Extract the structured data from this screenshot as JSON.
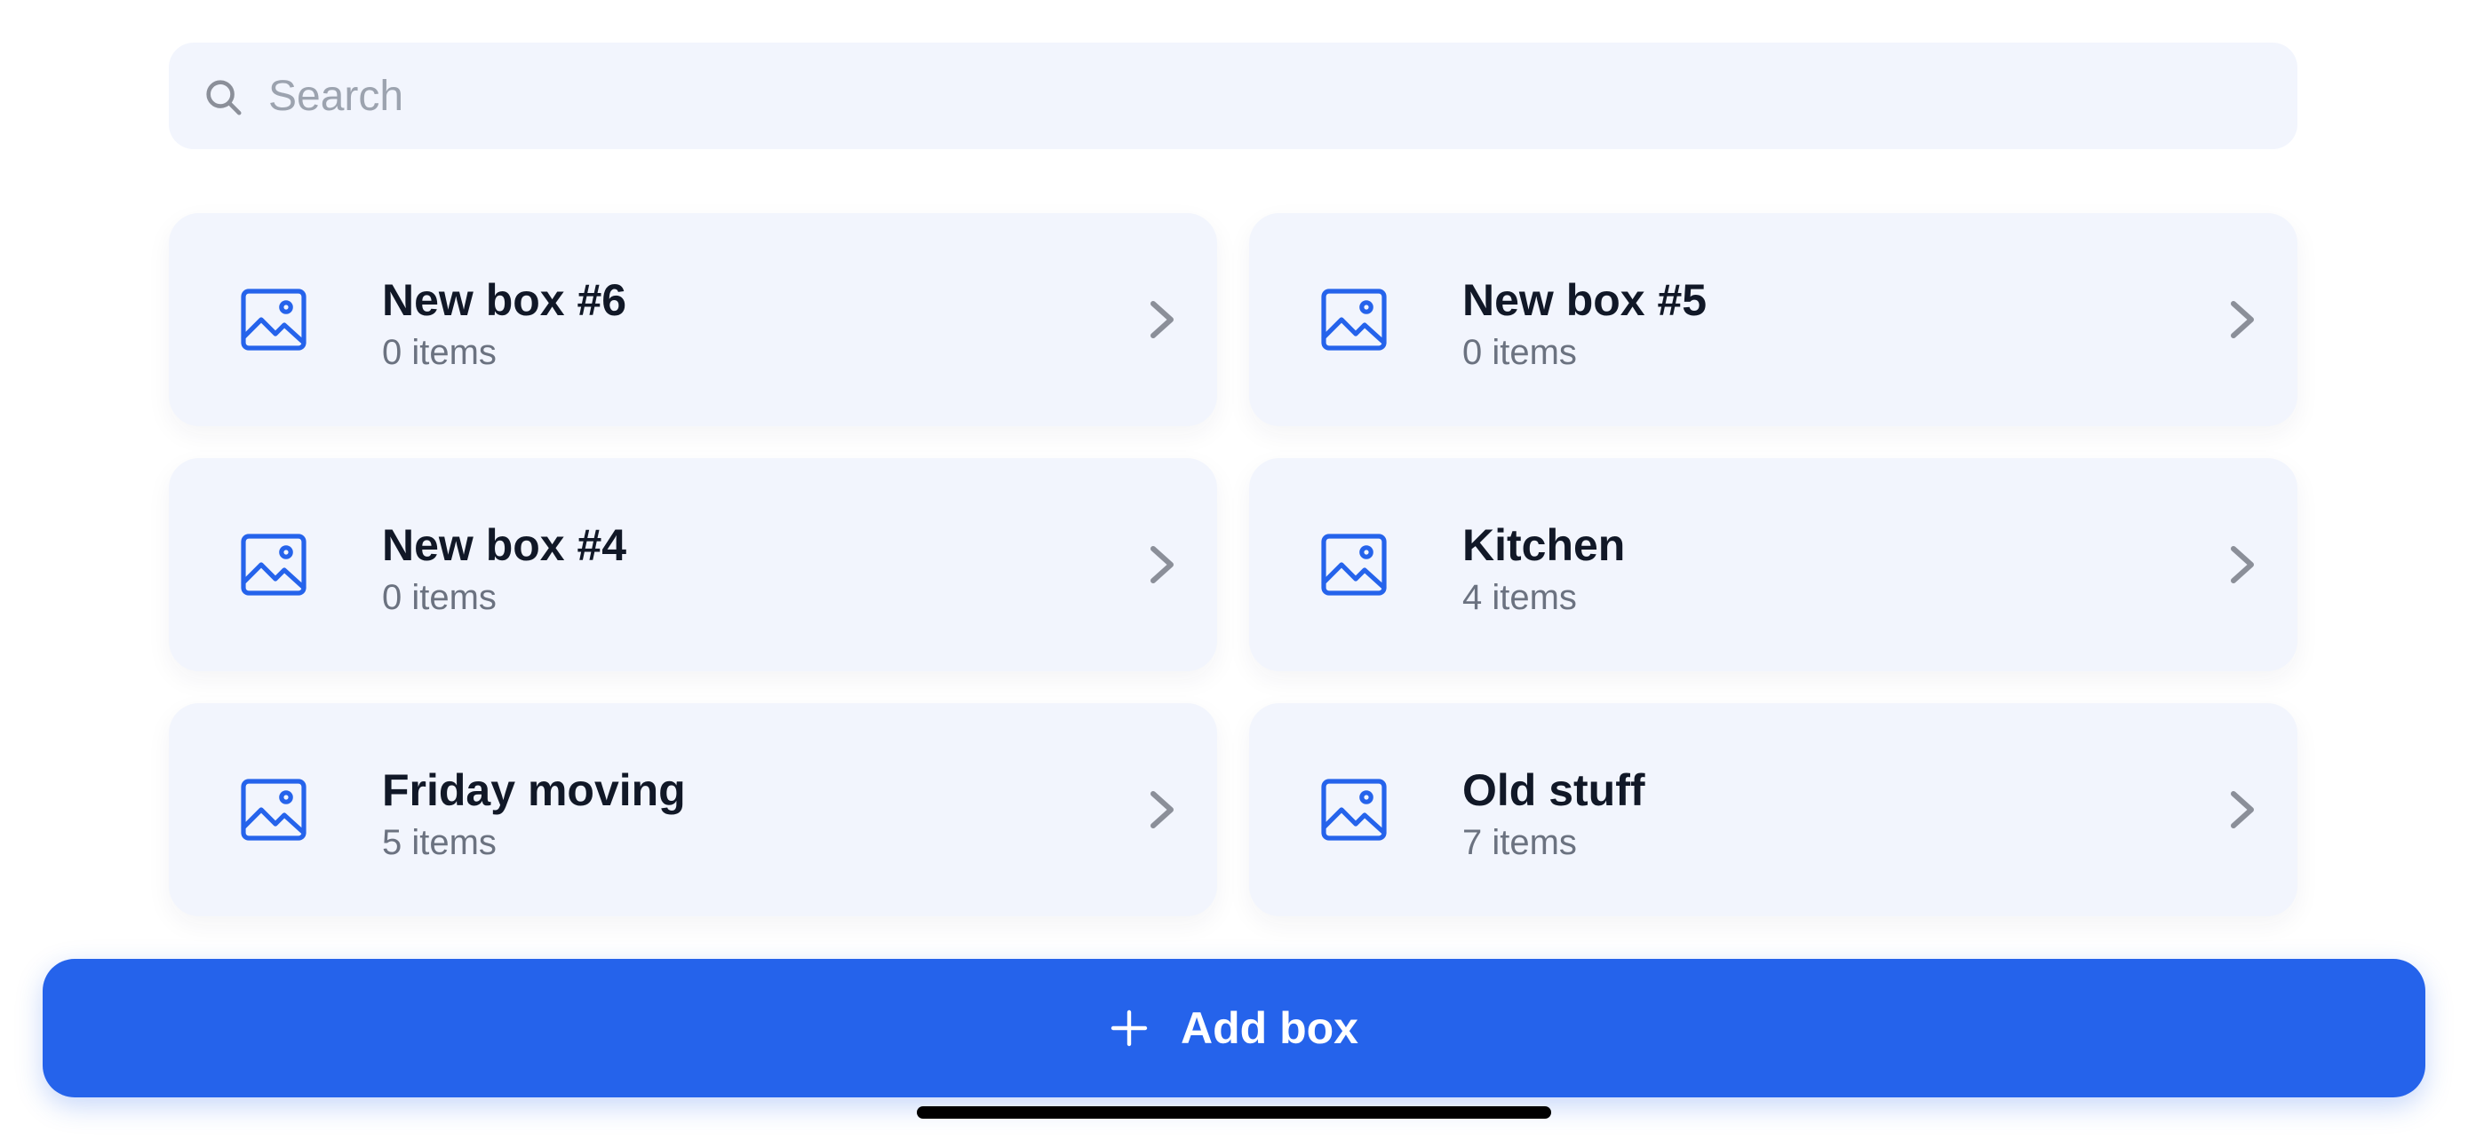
{
  "search": {
    "placeholder": "Search",
    "icon": "search-icon"
  },
  "boxes": [
    {
      "title": "New box #6",
      "count": "0 items",
      "icon": "image-icon"
    },
    {
      "title": "New box #5",
      "count": "0 items",
      "icon": "image-icon"
    },
    {
      "title": "New box #4",
      "count": "0 items",
      "icon": "image-icon"
    },
    {
      "title": "Kitchen",
      "count": "4 items",
      "icon": "image-icon"
    },
    {
      "title": "Friday moving",
      "count": "5 items",
      "icon": "image-icon"
    },
    {
      "title": "Old stuff",
      "count": "7 items",
      "icon": "image-icon"
    }
  ],
  "add_button": {
    "label": "Add box",
    "icon": "plus-icon"
  },
  "colors": {
    "accent": "#2563eb",
    "card_background": "#f2f5fd",
    "title_text": "#111827",
    "secondary_text": "#6b7280",
    "chevron": "#8b8f99"
  }
}
